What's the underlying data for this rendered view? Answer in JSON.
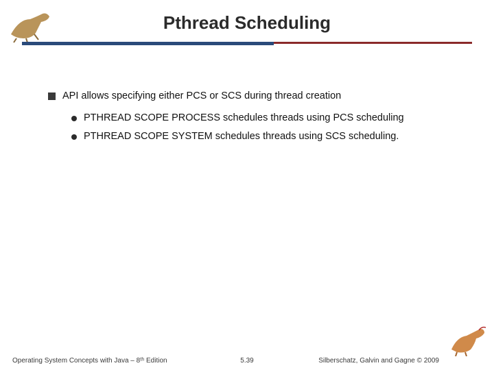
{
  "header": {
    "title": "Pthread Scheduling"
  },
  "content": {
    "main_point": "API allows specifying either PCS or SCS during thread creation",
    "sub_points": [
      "PTHREAD SCOPE PROCESS schedules threads using PCS scheduling",
      "PTHREAD SCOPE SYSTEM schedules threads using SCS scheduling."
    ]
  },
  "footer": {
    "left": "Operating System Concepts with Java – 8ᵗʰ Edition",
    "center": "5.39",
    "right": "Silberschatz, Galvin and Gagne © 2009"
  },
  "decor": {
    "dino_tl": "dinosaur-running-icon",
    "dino_br": "dinosaur-standing-icon"
  }
}
